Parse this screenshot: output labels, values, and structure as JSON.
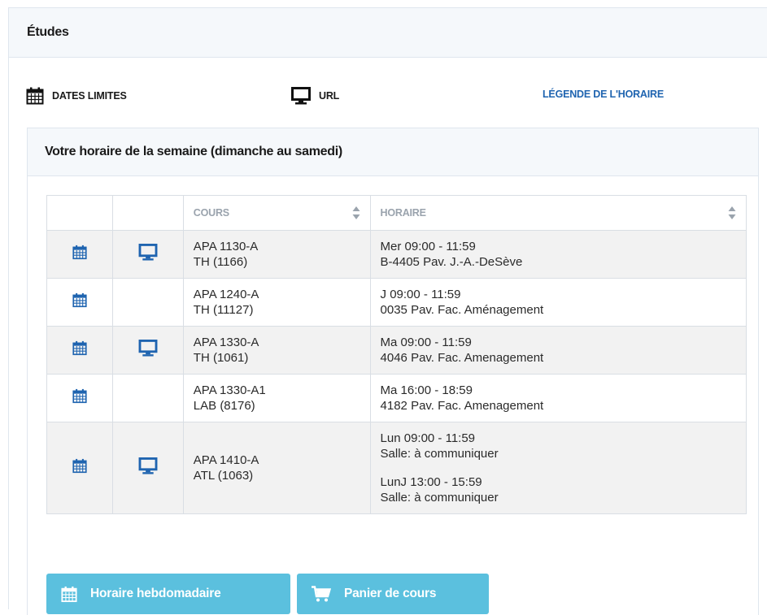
{
  "section": {
    "title": "Études"
  },
  "links": {
    "dates_limites": "DATES LIMITES",
    "url": "URL",
    "legende": "LÉGENDE DE L'HORAIRE"
  },
  "schedule": {
    "title": "Votre horaire de la semaine (dimanche au samedi)",
    "columns": {
      "cours": "COURS",
      "horaire": "HORAIRE"
    },
    "rows": [
      {
        "course": "APA 1130-A",
        "section": "TH (1166)",
        "has_url": true,
        "slots": [
          {
            "time": "Mer 09:00 - 11:59",
            "room": "B-4405 Pav. J.-A.-DeSève"
          }
        ]
      },
      {
        "course": "APA 1240-A",
        "section": "TH (11127)",
        "has_url": false,
        "slots": [
          {
            "time": "J 09:00 - 11:59",
            "room": "0035 Pav. Fac. Aménagement"
          }
        ]
      },
      {
        "course": "APA 1330-A",
        "section": "TH (1061)",
        "has_url": true,
        "slots": [
          {
            "time": "Ma 09:00 - 11:59",
            "room": "4046 Pav. Fac. Amenagement"
          }
        ]
      },
      {
        "course": "APA 1330-A1",
        "section": "LAB (8176)",
        "has_url": false,
        "slots": [
          {
            "time": "Ma 16:00 - 18:59",
            "room": "4182 Pav. Fac. Amenagement"
          }
        ]
      },
      {
        "course": "APA 1410-A",
        "section": "ATL (1063)",
        "has_url": true,
        "slots": [
          {
            "time": "Lun 09:00 - 11:59",
            "room": "Salle:  à communiquer"
          },
          {
            "time": "LunJ 13:00 - 15:59",
            "room": "Salle:  à communiquer"
          }
        ]
      }
    ]
  },
  "buttons": {
    "horaire": "Horaire hebdomadaire",
    "panier": "Panier de cours"
  },
  "colors": {
    "accent": "#1f64b0",
    "button": "#5bc0de",
    "header_bg": "#f5f8fb"
  },
  "icons": {
    "calendar": "calendar-icon",
    "monitor": "monitor-icon",
    "cart": "cart-icon",
    "sort": "sort-icon"
  }
}
